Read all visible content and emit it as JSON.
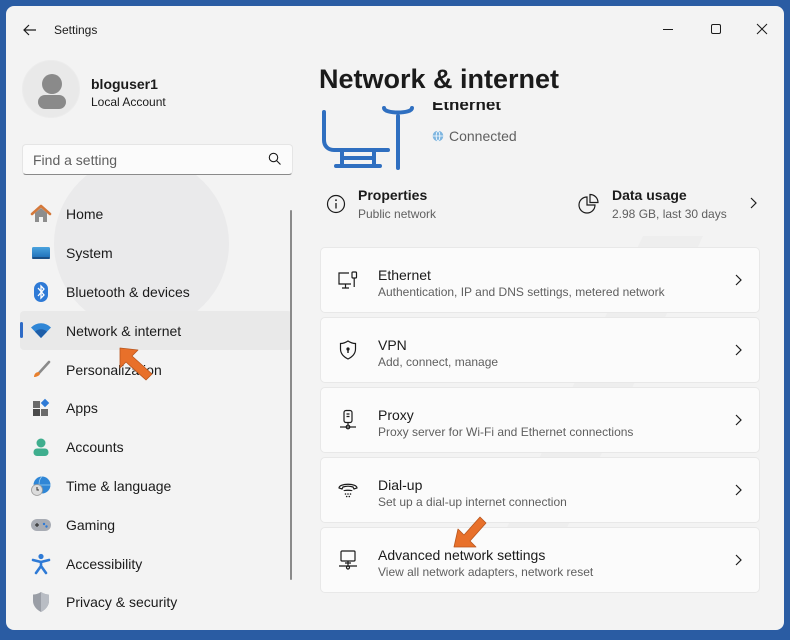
{
  "window": {
    "title": "Settings",
    "controls": {
      "minimize": "minimize",
      "maximize": "maximize",
      "close": "close"
    },
    "frame_color": "#2a5ca3"
  },
  "profile": {
    "name": "bloguser1",
    "account_type": "Local Account"
  },
  "search": {
    "placeholder": "Find a setting",
    "value": ""
  },
  "sidebar": {
    "items": [
      {
        "label": "Home",
        "icon": "home-icon"
      },
      {
        "label": "System",
        "icon": "system-icon"
      },
      {
        "label": "Bluetooth & devices",
        "icon": "bluetooth-icon"
      },
      {
        "label": "Network & internet",
        "icon": "wifi-icon",
        "active": true
      },
      {
        "label": "Personalization",
        "icon": "paintbrush-icon"
      },
      {
        "label": "Apps",
        "icon": "apps-icon"
      },
      {
        "label": "Accounts",
        "icon": "accounts-icon"
      },
      {
        "label": "Time & language",
        "icon": "globe-clock-icon"
      },
      {
        "label": "Gaming",
        "icon": "gamepad-icon"
      },
      {
        "label": "Accessibility",
        "icon": "accessibility-icon"
      },
      {
        "label": "Privacy & security",
        "icon": "shield-icon"
      }
    ],
    "accent": "#2e6bc6"
  },
  "main": {
    "title": "Network & internet",
    "connection": {
      "name": "Ethernet",
      "status": "Connected"
    },
    "properties": {
      "title": "Properties",
      "subtitle": "Public network"
    },
    "data_usage": {
      "title": "Data usage",
      "subtitle": "2.98 GB, last 30 days"
    },
    "cards": [
      {
        "title": "Ethernet",
        "subtitle": "Authentication, IP and DNS settings, metered network",
        "icon": "ethernet-icon"
      },
      {
        "title": "VPN",
        "subtitle": "Add, connect, manage",
        "icon": "vpn-shield-icon"
      },
      {
        "title": "Proxy",
        "subtitle": "Proxy server for Wi-Fi and Ethernet connections",
        "icon": "proxy-icon"
      },
      {
        "title": "Dial-up",
        "subtitle": "Set up a dial-up internet connection",
        "icon": "dialup-icon"
      },
      {
        "title": "Advanced network settings",
        "subtitle": "View all network adapters, network reset",
        "icon": "advanced-network-icon"
      }
    ]
  },
  "annotations": {
    "arrow_color": "#e8702a"
  }
}
